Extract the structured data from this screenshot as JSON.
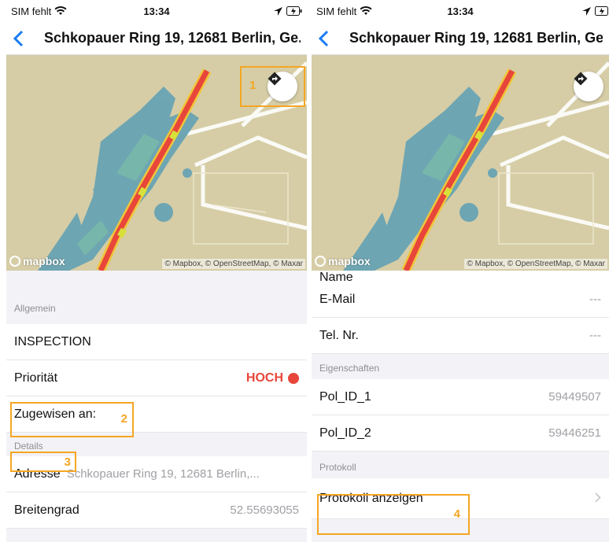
{
  "status": {
    "carrier": "SIM fehlt",
    "time": "13:34"
  },
  "nav": {
    "title": "Schkopauer Ring 19, 12681 Berlin, Ge..."
  },
  "map": {
    "brand": "mapbox",
    "attribution": "© Mapbox, © OpenStreetMap, © Maxar"
  },
  "left": {
    "section_general": "Allgemein",
    "type_value": "INSPECTION",
    "priority_label": "Priorität",
    "priority_value": "HOCH",
    "assigned_label": "Zugewisen an:",
    "section_details": "Details",
    "address_label": "Adresse",
    "address_value": "Schkopauer Ring 19, 12681 Berlin,...",
    "lat_label": "Breitengrad",
    "lat_value": "52.55693055"
  },
  "right": {
    "partial_label": "Name",
    "email_label": "E-Mail",
    "email_value": "---",
    "phone_label": "Tel. Nr.",
    "phone_value": "---",
    "section_props": "Eigenschaften",
    "pol1_label": "Pol_ID_1",
    "pol1_value": "59449507",
    "pol2_label": "Pol_ID_2",
    "pol2_value": "59446251",
    "section_protocol": "Protokoll",
    "protocol_label": "Protokoll anzeigen"
  },
  "annotations": {
    "a1": "1",
    "a2": "2",
    "a3": "3",
    "a4": "4"
  },
  "colors": {
    "accent": "#1a7cf5",
    "priority_high": "#e8463a",
    "annotation": "#f5a623"
  }
}
